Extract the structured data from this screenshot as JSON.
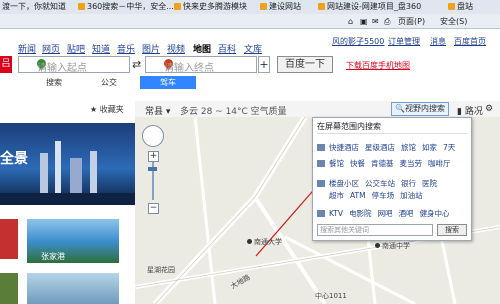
{
  "favorites": [
    "渡一下，你就知道",
    "360搜索－中华，安全...",
    "快来史多腾游模块",
    "建设网站",
    "网站建设-网建项目_盘360",
    "盘站"
  ],
  "cmdbar": {
    "page": "页面(P)",
    "safety": "安全(S)"
  },
  "nav": {
    "items": [
      "新闻",
      "网页",
      "贴吧",
      "知道",
      "音乐",
      "图片",
      "视频",
      "地图",
      "百科",
      "文库"
    ],
    "active": "地图"
  },
  "account": {
    "user": "风的影子5500",
    "orders": "订单管理",
    "msgs": "消息",
    "home": "百度首页"
  },
  "search": {
    "start_placeholder": "请输入起点",
    "end_placeholder": "请输入终点",
    "button": "百度一下",
    "mobile_link": "下载百度手机地图",
    "tabs": [
      "搜索",
      "公交",
      "驾车"
    ],
    "active_tab": "驾车"
  },
  "left": {
    "fav": "收藏夹",
    "banner": "全景",
    "img_caption": "张家港"
  },
  "toolbar": {
    "city": "常县",
    "weather": "多云 28 ~ 14°C  空气质量",
    "view_btn": "视野内搜索",
    "traffic": "路况",
    "tools": "工具"
  },
  "popup": {
    "title": "在屏幕范围内搜索",
    "rows": [
      {
        "icon": "hotel-icon",
        "items": [
          "快捷酒店",
          "星级酒店",
          "旅馆",
          "如家",
          "7天"
        ]
      },
      {
        "icon": "food-icon",
        "items": [
          "餐馆",
          "快餐",
          "肯德基",
          "麦当劳",
          "咖啡厅"
        ]
      },
      {
        "icon": "life-icon",
        "items": [
          "银行",
          "公交站",
          "银行",
          "医院"
        ]
      },
      {
        "icon": "shop-icon",
        "items": [
          "超市",
          "ATM",
          "停车场",
          "加油站"
        ]
      },
      {
        "icon": "fun-icon",
        "items": [
          "KTV",
          "电影院",
          "网吧",
          "酒吧",
          "健身中心"
        ]
      }
    ],
    "row2_override": [
      "楼盘小区",
      "公交车站",
      "银行",
      "医院"
    ],
    "search_placeholder": "搜索其他关键词",
    "search_btn": "搜索"
  },
  "map_labels": [
    "南通大学",
    "南通中学",
    "星湖花园",
    "大地路",
    "中心1011"
  ]
}
